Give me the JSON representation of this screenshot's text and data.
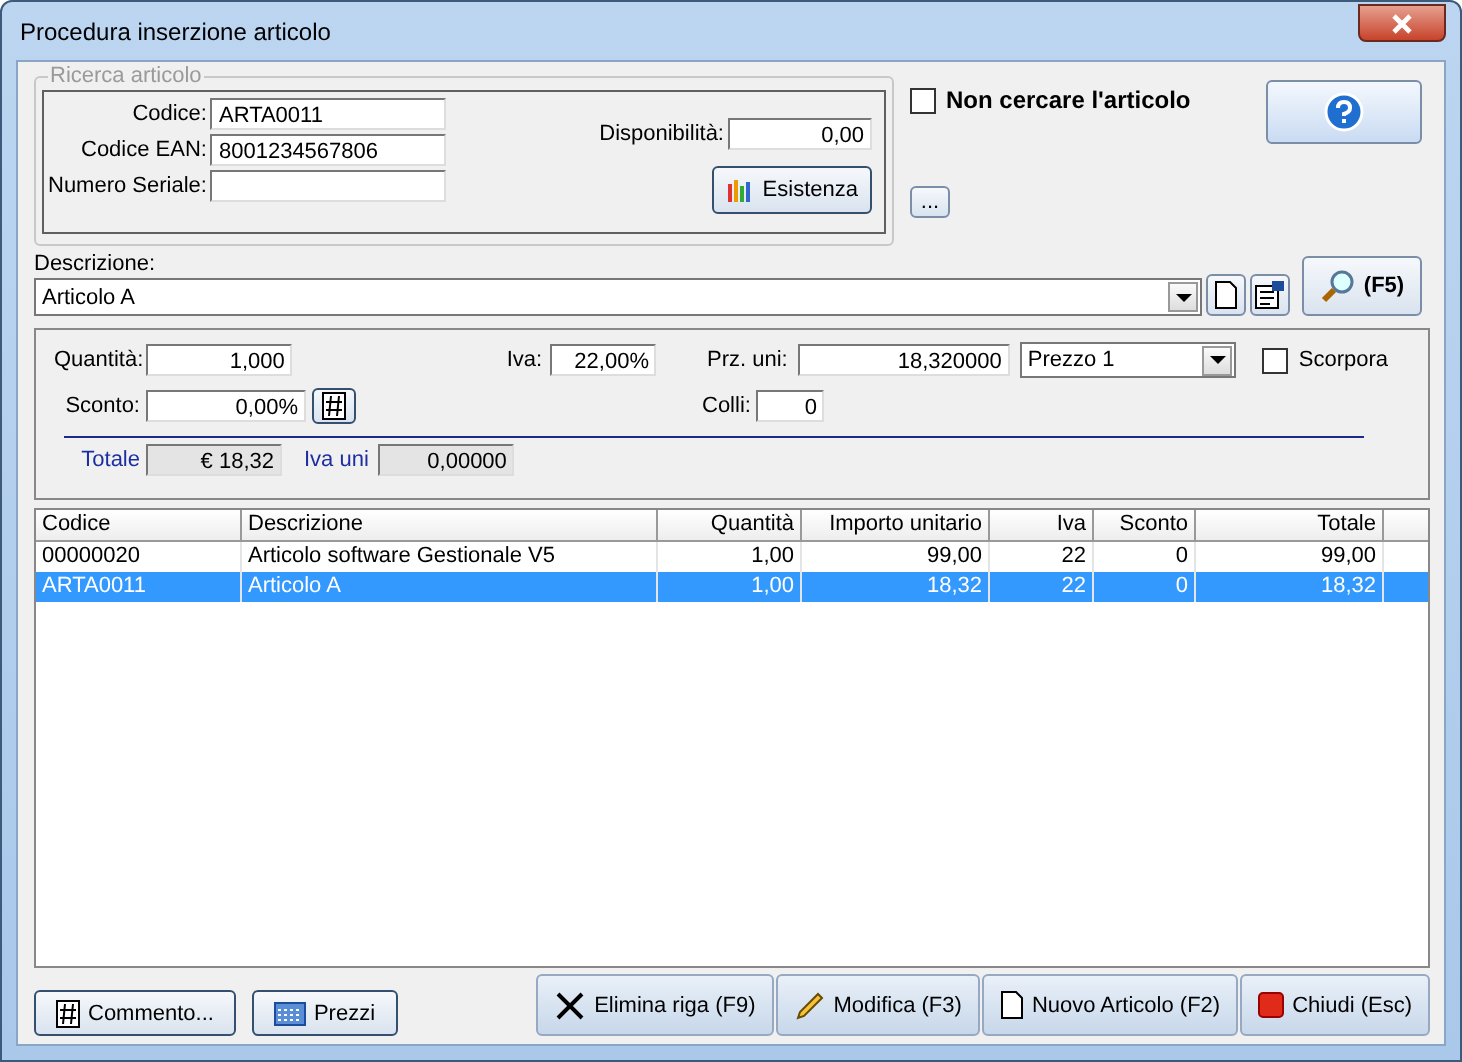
{
  "window": {
    "title": "Procedura inserzione articolo"
  },
  "search": {
    "legend": "Ricerca articolo",
    "fields": [
      {
        "label": "Codice:",
        "value": "ARTA0011"
      },
      {
        "label": "Codice EAN:",
        "value": "8001234567806"
      },
      {
        "label": "Numero Seriale:"
      }
    ],
    "availability": {
      "label": "Disponibilità:",
      "value": "0,00"
    },
    "stock_button": "Esistenza",
    "skip_search": {
      "label": "Non cercare l'articolo",
      "checked": false
    },
    "more_button": "...",
    "description": {
      "label": "Descrizione:",
      "value": "Articolo A"
    },
    "find_button": "(F5)"
  },
  "line": {
    "quantity": {
      "label": "Quantità:",
      "value": "1,000"
    },
    "vat": {
      "label": "Iva:",
      "value": "22,00%"
    },
    "unit_price": {
      "label": "Prz. uni:",
      "value": "18,320000"
    },
    "price_list": "Prezzo 1",
    "scorpora": {
      "label": "Scorpora",
      "checked": false
    },
    "discount": {
      "label": "Sconto:",
      "value": "0,00%"
    },
    "packages": {
      "label": "Colli:",
      "value": "0"
    },
    "total": {
      "label": "Totale",
      "value": "€ 18,32"
    },
    "unit_vat": {
      "label": "Iva uni",
      "value": "0,00000"
    }
  },
  "table": {
    "columns": [
      "Codice",
      "Descrizione",
      "Quantità",
      "Importo unitario",
      "Iva",
      "Sconto",
      "Totale"
    ],
    "rows": [
      {
        "cells": [
          "00000020",
          "Articolo software Gestionale V5",
          "1,00",
          "99,00",
          "22",
          "0",
          "99,00"
        ],
        "selected": false
      },
      {
        "cells": [
          "ARTA0011",
          "Articolo A",
          "1,00",
          "18,32",
          "22",
          "0",
          "18,32"
        ],
        "selected": true
      }
    ]
  },
  "left_buttons": [
    {
      "kind": "hash",
      "label": "Commento..."
    },
    {
      "kind": "calc",
      "label": "Prezzi"
    }
  ],
  "right_buttons": [
    {
      "kind": "cross",
      "label": "Elimina riga (F9)"
    },
    {
      "kind": "pencil",
      "label": "Modifica (F3)"
    },
    {
      "kind": "page",
      "label": "Nuovo Articolo (F2)"
    },
    {
      "kind": "stop",
      "label": "Chiudi (Esc)"
    }
  ]
}
